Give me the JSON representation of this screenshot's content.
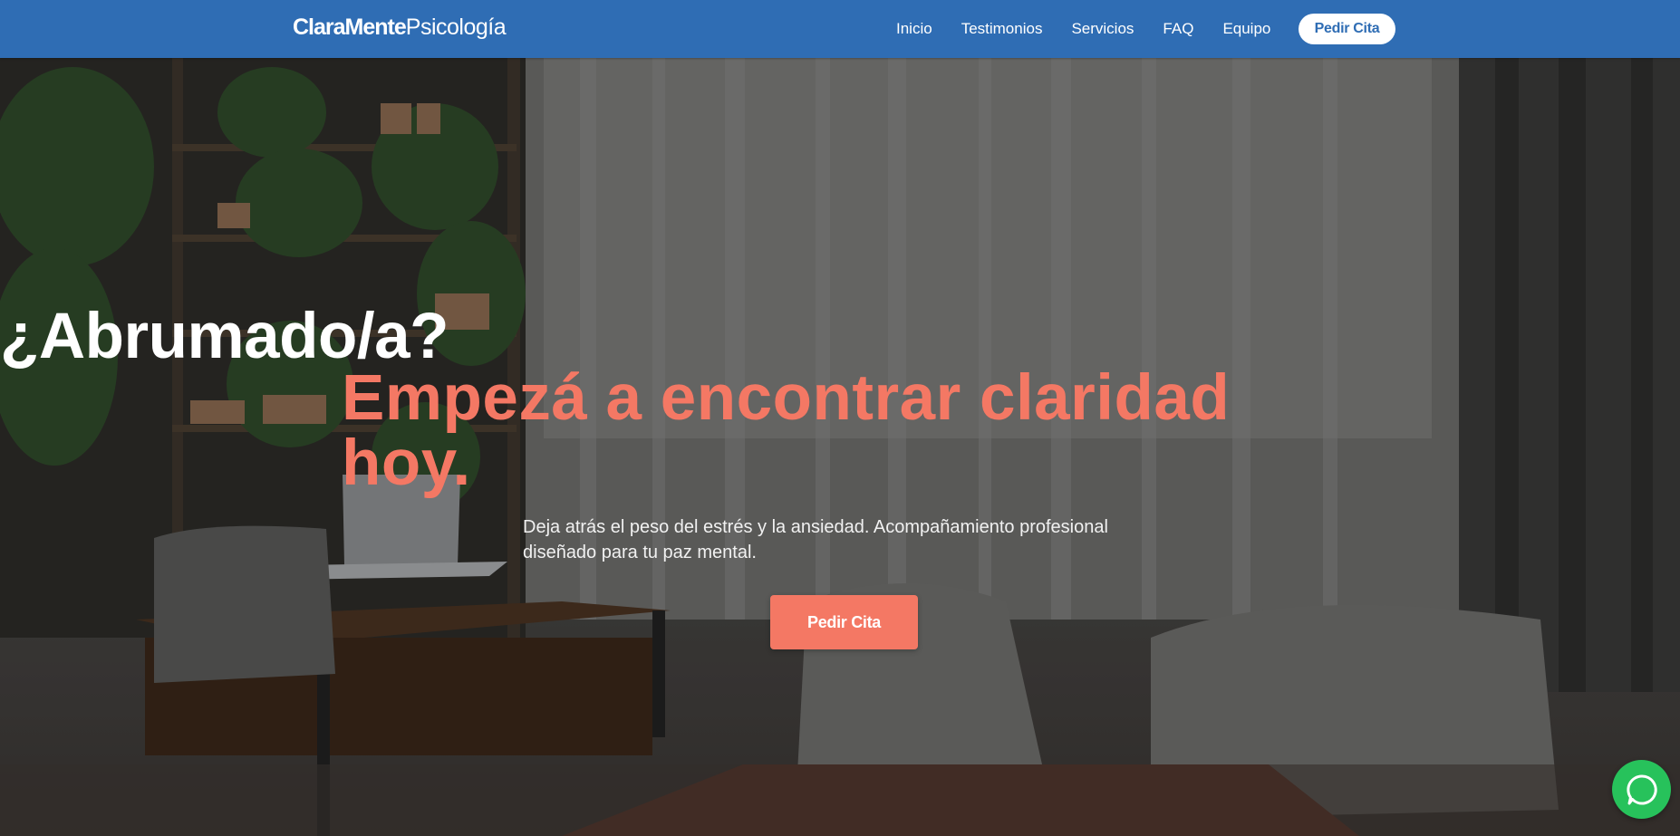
{
  "nav": {
    "logo_bold": "ClaraMente",
    "logo_light": "Psicología",
    "links": [
      {
        "label": "Inicio"
      },
      {
        "label": "Testimonios"
      },
      {
        "label": "Servicios"
      },
      {
        "label": "FAQ"
      },
      {
        "label": "Equipo"
      }
    ],
    "cta_label": "Pedir Cita"
  },
  "hero": {
    "headline_white": "¿Abrumado/a?",
    "headline_accent": "Empezá a encontrar claridad hoy.",
    "subtitle": "Deja atrás el peso del estrés y la ansiedad. Acompañamiento profesional diseñado para tu paz mental.",
    "cta_label": "Pedir Cita"
  },
  "floating": {
    "whatsapp_icon": "whatsapp-chat-icon"
  },
  "colors": {
    "nav_background": "#2f6db4",
    "accent": "#f47864",
    "whatsapp": "#27c25b"
  }
}
